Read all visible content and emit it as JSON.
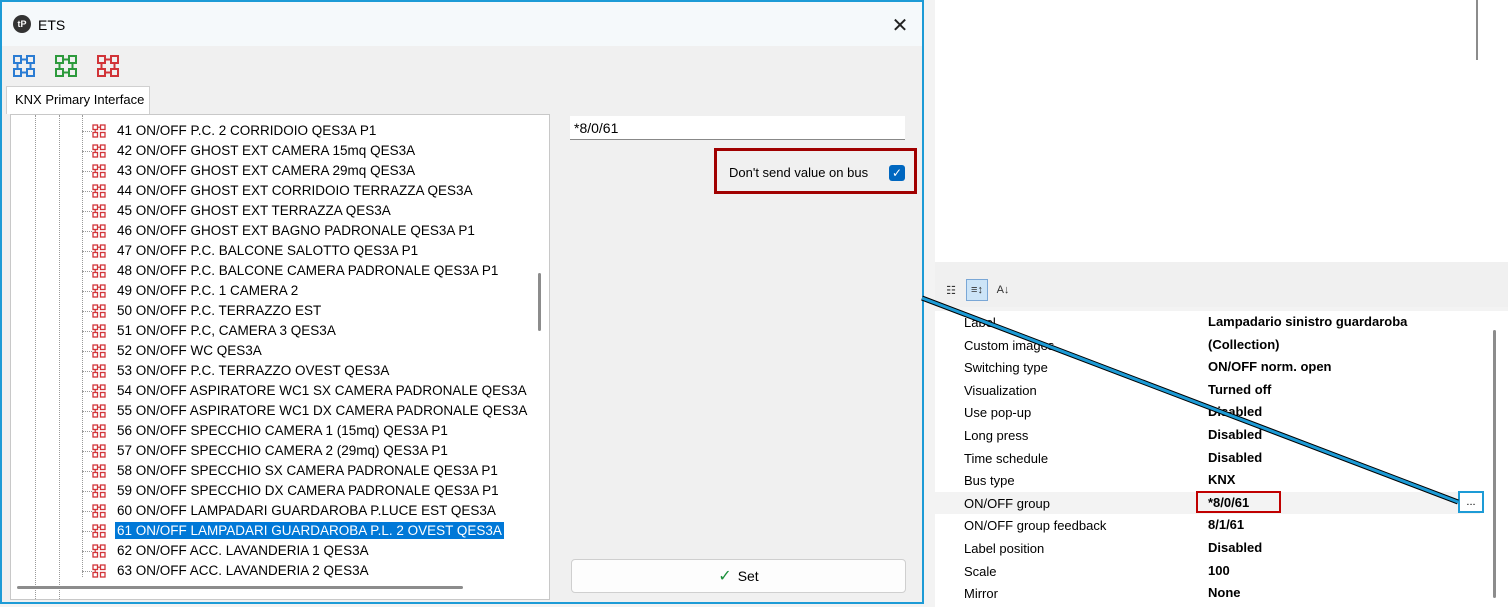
{
  "dialog": {
    "title": "ETS",
    "app_icon_text": "tP",
    "close_glyph": "✕",
    "tab_label": "KNX Primary Interface",
    "toolbar_icons": [
      {
        "icon": "network-icon",
        "color": "#2b7cd3"
      },
      {
        "icon": "network-icon",
        "color": "#2d9a3c"
      },
      {
        "icon": "network-icon",
        "color": "#d13438"
      }
    ],
    "tree_items": [
      {
        "label": "41 ON/OFF P.C. 2 CORRIDOIO QES3A P1"
      },
      {
        "label": "42 ON/OFF GHOST EXT CAMERA 15mq QES3A"
      },
      {
        "label": "43 ON/OFF GHOST EXT CAMERA 29mq QES3A"
      },
      {
        "label": "44 ON/OFF GHOST EXT CORRIDOIO TERRAZZA QES3A"
      },
      {
        "label": "45 ON/OFF GHOST EXT TERRAZZA QES3A"
      },
      {
        "label": "46 ON/OFF GHOST EXT BAGNO PADRONALE QES3A P1"
      },
      {
        "label": "47 ON/OFF P.C. BALCONE SALOTTO QES3A P1"
      },
      {
        "label": "48 ON/OFF P.C. BALCONE CAMERA PADRONALE QES3A P1"
      },
      {
        "label": "49 ON/OFF P.C. 1 CAMERA 2"
      },
      {
        "label": "50 ON/OFF P.C. TERRAZZO EST"
      },
      {
        "label": "51 ON/OFF P.C, CAMERA 3 QES3A"
      },
      {
        "label": "52 ON/OFF WC QES3A"
      },
      {
        "label": "53 ON/OFF P.C.  TERRAZZO OVEST QES3A"
      },
      {
        "label": "54 ON/OFF ASPIRATORE WC1 SX CAMERA PADRONALE QES3A"
      },
      {
        "label": "55 ON/OFF ASPIRATORE WC1 DX CAMERA PADRONALE QES3A"
      },
      {
        "label": "56 ON/OFF SPECCHIO CAMERA 1 (15mq)  QES3A P1"
      },
      {
        "label": "57 ON/OFF SPECCHIO CAMERA 2 (29mq)  QES3A P1"
      },
      {
        "label": "58 ON/OFF SPECCHIO SX CAMERA PADRONALE QES3A P1"
      },
      {
        "label": "59 ON/OFF SPECCHIO DX CAMERA PADRONALE QES3A P1"
      },
      {
        "label": "60 ON/OFF LAMPADARI GUARDAROBA P.LUCE EST QES3A"
      },
      {
        "label": "61 ON/OFF LAMPADARI GUARDAROBA P.L. 2 OVEST QES3A",
        "selected": true
      },
      {
        "label": "62 ON/OFF ACC. LAVANDERIA 1 QES3A"
      },
      {
        "label": "63 ON/OFF ACC. LAVANDERIA 2 QES3A"
      }
    ],
    "address_value": "*8/0/61",
    "dont_send_label": "Don't send value on bus",
    "dont_send_checked": true,
    "checkmark_glyph": "✓",
    "set_label": "Set",
    "set_icon_glyph": "✓"
  },
  "properties": {
    "toolbar": [
      {
        "icon": "categorized-icon"
      },
      {
        "icon": "sort-order-icon",
        "selected": true
      },
      {
        "icon": "sort-alpha-icon"
      }
    ],
    "rows": [
      {
        "label": "Label",
        "value": "Lampadario sinistro guardaroba"
      },
      {
        "label": "Custom images",
        "value": "(Collection)"
      },
      {
        "label": "Switching type",
        "value": "ON/OFF norm. open"
      },
      {
        "label": "Visualization",
        "value": "Turned off"
      },
      {
        "label": "Use pop-up",
        "value": "Disabled"
      },
      {
        "label": "Long press",
        "value": "Disabled"
      },
      {
        "label": "Time schedule",
        "value": "Disabled"
      },
      {
        "label": "Bus type",
        "value": "KNX"
      },
      {
        "label": "ON/OFF group",
        "value": "*8/0/61",
        "highlight": true
      },
      {
        "label": "ON/OFF group feedback",
        "value": "8/1/61"
      },
      {
        "label": "Label position",
        "value": "Disabled"
      },
      {
        "label": "Scale",
        "value": "100"
      },
      {
        "label": "Mirror",
        "value": "None"
      }
    ],
    "ellipsis_label": "..."
  },
  "colors": {
    "accent": "#1d9bd6",
    "highlight_border": "#c00000",
    "selection": "#0078d7",
    "tree_icon": "#d13438"
  }
}
